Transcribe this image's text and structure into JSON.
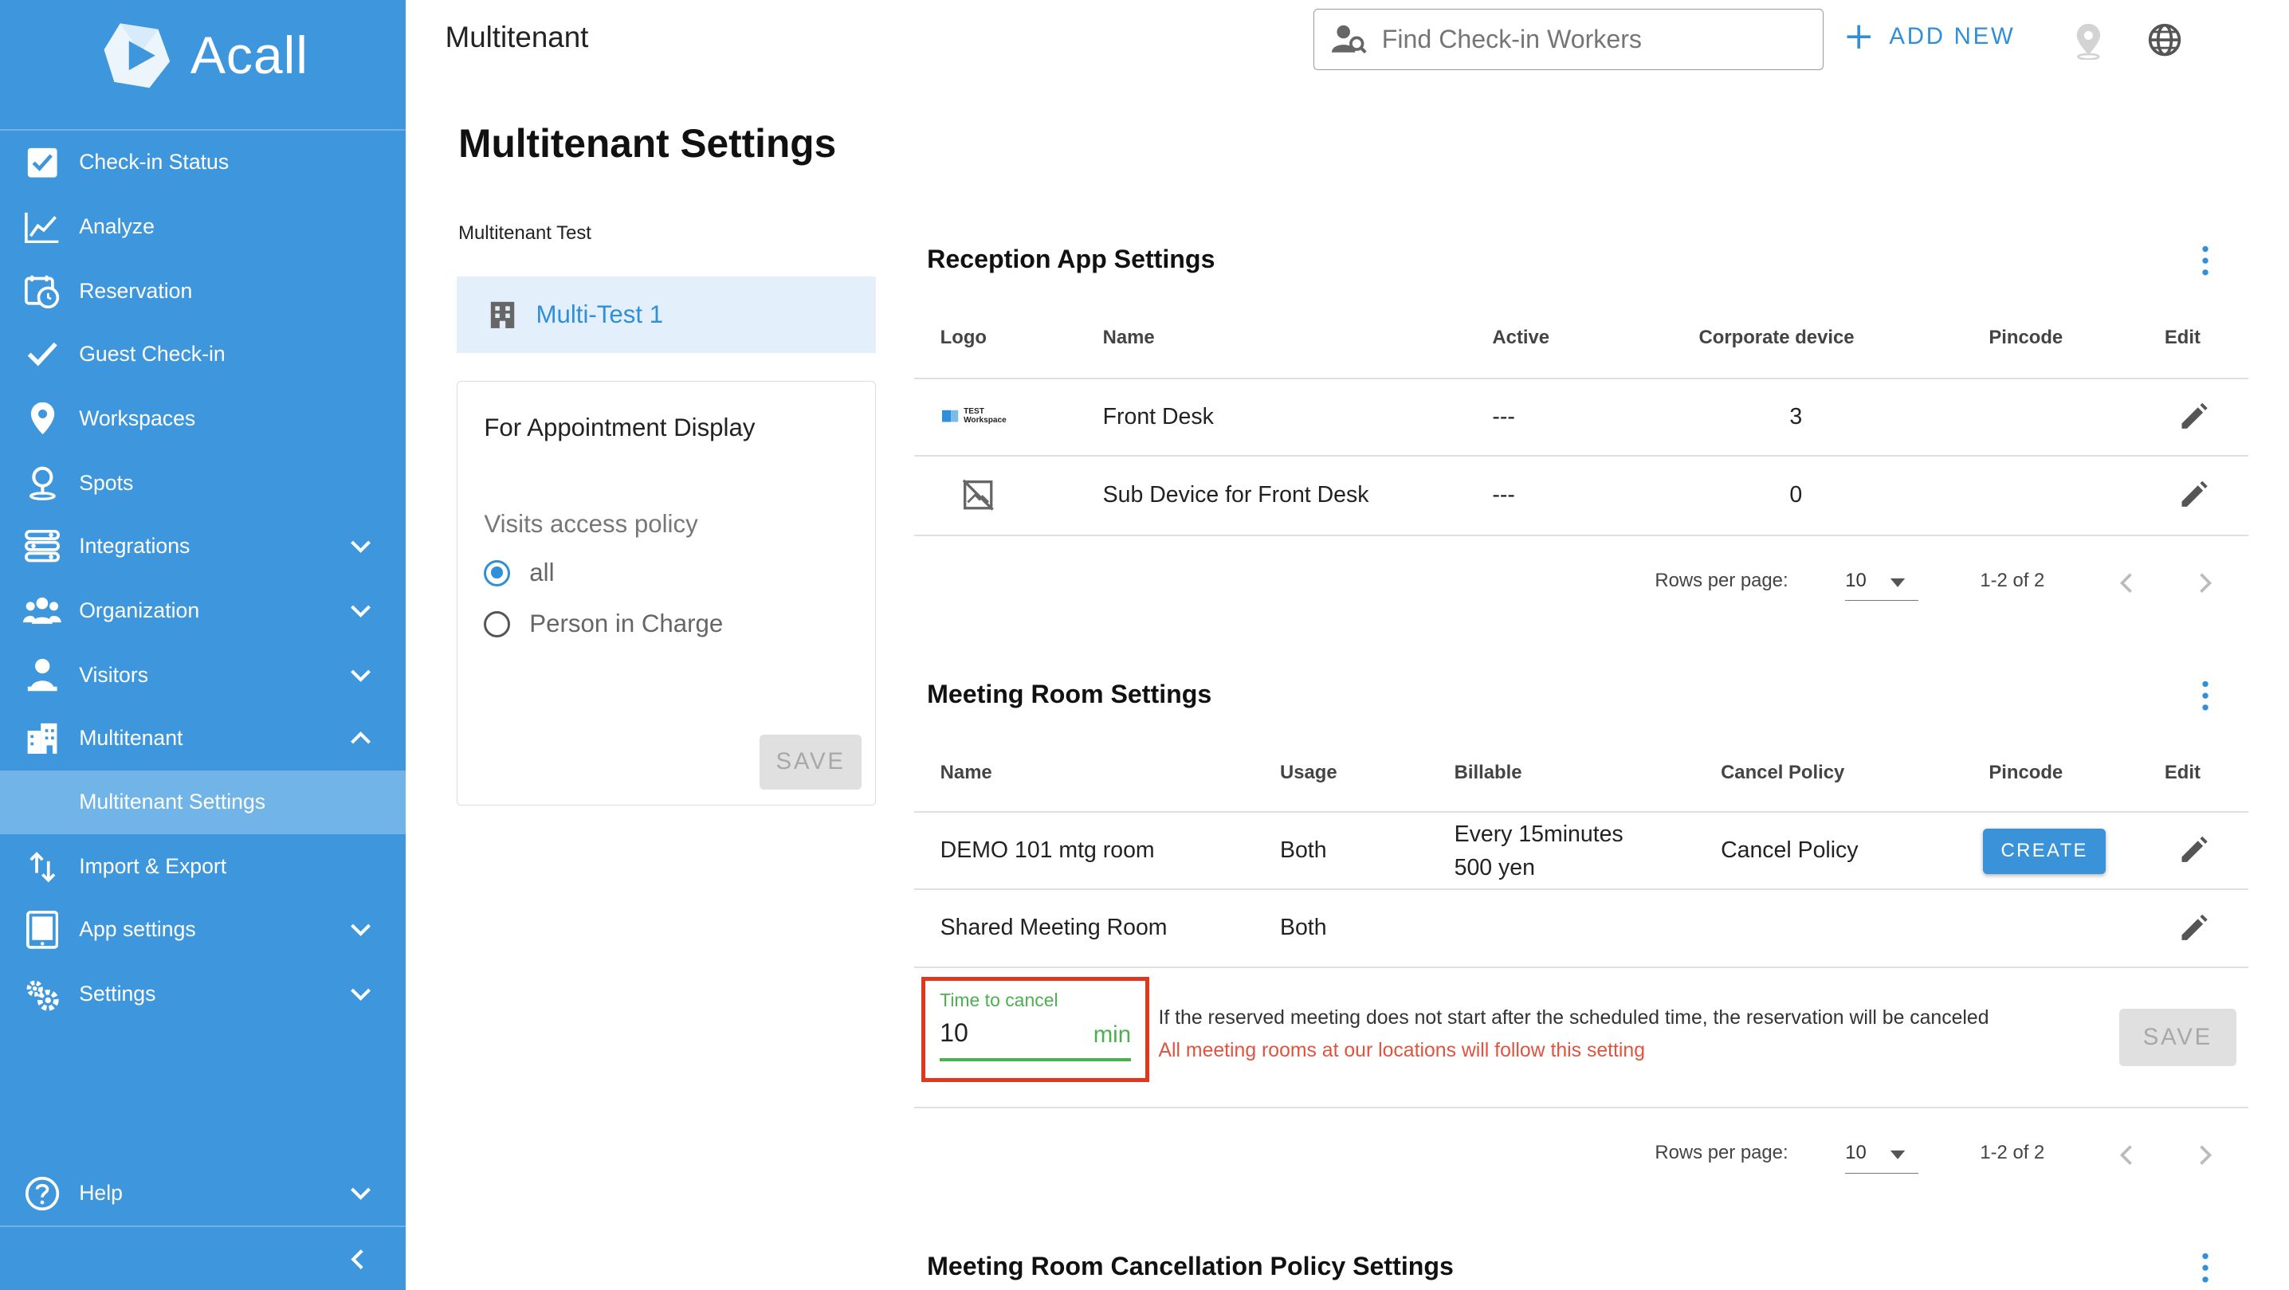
{
  "app": {
    "brand": "Acall",
    "accent_color": "#3e97dc",
    "highlight_color": "#e0371f"
  },
  "sidebar": {
    "items": [
      {
        "label": "Check-in Status",
        "icon": "checkbox-icon"
      },
      {
        "label": "Analyze",
        "icon": "chart-icon"
      },
      {
        "label": "Reservation",
        "icon": "calendar-clock-icon"
      },
      {
        "label": "Guest Check-in",
        "icon": "check-icon"
      },
      {
        "label": "Workspaces",
        "icon": "location-pin-icon"
      },
      {
        "label": "Spots",
        "icon": "spot-pin-icon"
      },
      {
        "label": "Integrations",
        "icon": "integrations-icon"
      },
      {
        "label": "Organization",
        "icon": "people-icon"
      },
      {
        "label": "Visitors",
        "icon": "visitor-icon"
      },
      {
        "label": "Multitenant",
        "icon": "building-icon"
      },
      {
        "label": "Multitenant Settings",
        "icon": ""
      },
      {
        "label": "Import & Export",
        "icon": "import-export-icon"
      },
      {
        "label": "App settings",
        "icon": "tablet-icon"
      },
      {
        "label": "Settings",
        "icon": "gears-icon"
      }
    ],
    "help": "Help"
  },
  "topbar": {
    "title": "Multitenant",
    "search_placeholder": "Find Check-in Workers",
    "add_new": "ADD NEW"
  },
  "page": {
    "title": "Multitenant Settings"
  },
  "left_panel": {
    "label": "Multitenant Test",
    "tenant": "Multi-Test 1",
    "card_title": "For Appointment Display",
    "policy_label": "Visits access policy",
    "options": [
      "all",
      "Person in Charge"
    ],
    "selected": "all",
    "save": "SAVE"
  },
  "reception": {
    "title": "Reception App Settings",
    "columns": [
      "Logo",
      "Name",
      "Active",
      "Corporate device",
      "Pincode",
      "Edit"
    ],
    "rows": [
      {
        "logo": "TEST Workspace",
        "name": "Front Desk",
        "active": "---",
        "corporate_device": "3",
        "pincode": ""
      },
      {
        "logo": "",
        "name": "Sub Device for Front Desk",
        "active": "---",
        "corporate_device": "0",
        "pincode": ""
      }
    ],
    "rows_per_page_label": "Rows per page:",
    "rows_per_page": "10",
    "range": "1-2 of 2"
  },
  "meeting": {
    "title": "Meeting Room Settings",
    "columns": [
      "Name",
      "Usage",
      "Billable",
      "Cancel Policy",
      "Pincode",
      "Edit"
    ],
    "rows": [
      {
        "name": "DEMO 101 mtg room",
        "usage": "Both",
        "billable_1": "Every 15minutes",
        "billable_2": "500 yen",
        "cancel_policy": "Cancel Policy",
        "pincode": "CREATE"
      },
      {
        "name": "Shared Meeting Room",
        "usage": "Both",
        "billable_1": "",
        "billable_2": "",
        "cancel_policy": "",
        "pincode": ""
      }
    ],
    "time_to_cancel": {
      "label": "Time to cancel",
      "value": "10",
      "unit": "min",
      "description": "If the reserved meeting does not start after the scheduled time, the reservation will be canceled",
      "warning": "All meeting rooms at our locations will follow this setting",
      "save": "SAVE"
    },
    "rows_per_page_label": "Rows per page:",
    "rows_per_page": "10",
    "range": "1-2 of 2"
  },
  "cancellation_policy": {
    "title": "Meeting Room Cancellation Policy Settings"
  }
}
